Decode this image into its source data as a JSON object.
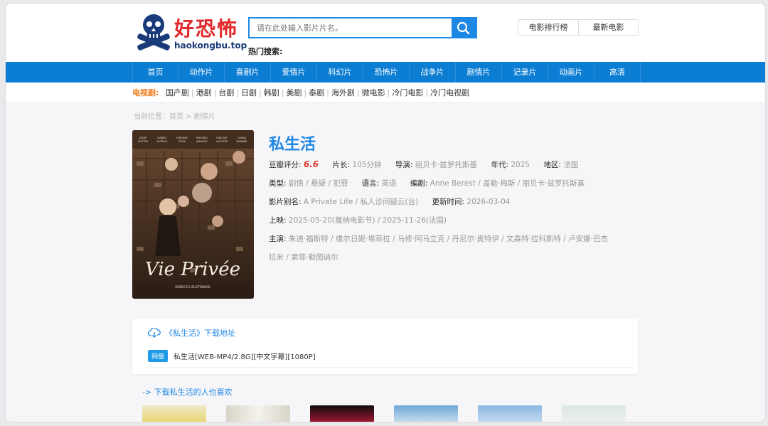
{
  "header": {
    "logo_title": "好恐怖",
    "logo_domain": "haokongbu.top",
    "search_placeholder": "请在此处输入影片片名。",
    "hot_label": "热门搜索:",
    "top_links": [
      "电影排行榜",
      "最新电影"
    ]
  },
  "nav": {
    "items": [
      "首页",
      "动作片",
      "喜剧片",
      "爱情片",
      "科幻片",
      "恐怖片",
      "战争片",
      "剧情片",
      "记录片",
      "动画片",
      "高清"
    ]
  },
  "tv": {
    "label": "电视剧:",
    "items": [
      "国产剧",
      "港剧",
      "台剧",
      "日剧",
      "韩剧",
      "美剧",
      "泰剧",
      "海外剧",
      "微电影",
      "冷门电影",
      "冷门电视剧"
    ]
  },
  "breadcrumb": "当前位置：首页 > 剧情片",
  "poster": {
    "title_text": "Vie Privée",
    "director_credit": "REBECCA ZLOTOWSKI",
    "cast_names": [
      "JODIE FOSTER",
      "DANIEL AUTEUIL",
      "VIRGINIE EFIRA",
      "MATHIEU AMALRIC",
      "VINCENT LACOSTE",
      "LUANA BAJRAMI"
    ]
  },
  "movie": {
    "title": "私生活",
    "rating_label": "豆瓣评分:",
    "rating": "6.6",
    "length_label": "片长:",
    "length": "105分钟",
    "director_label": "导演:",
    "director": "丽贝卡·兹罗托斯基",
    "year_label": "年代:",
    "year": "2025",
    "region_label": "地区:",
    "region": "法国",
    "type_label": "类型:",
    "type": "剧情 / 悬疑 / 犯罪",
    "language_label": "语言:",
    "language": "英语",
    "writer_label": "编剧:",
    "writer": "Anne Berest / 盖勒·梅斯 / 丽贝卡·兹罗托斯基",
    "aka_label": "影片别名:",
    "aka": "A Private Life / 私人诊间疑云(台)",
    "updated_label": "更新时间:",
    "updated": "2026-03-04",
    "release_label": "上映:",
    "release": "2025-05-20(戛纳电影节) / 2025-11-26(法国)",
    "cast_label": "主演:",
    "cast_line1": "朱迪·福斯特 / 维尔日妮·埃菲拉 / 马修·阿马立克 / 丹尼尔·奥特伊 / 文森特·拉科斯特 / 卢安娜·巴杰",
    "cast_line2": "拉米 / 索菲·勒图讷尔"
  },
  "download": {
    "heading": "《私生活》下载地址",
    "badge": "网盘",
    "file": "私生活[WEB-MP4/2.8G][中文字幕][1080P]"
  },
  "also_like": "-> 下载私生活的人也喜欢",
  "colors": {
    "accent": "#1e88e5",
    "nav": "#0b7dd3",
    "logo_red": "#e22828",
    "tv_label": "#f07b1a",
    "score": "#e83b2c"
  }
}
